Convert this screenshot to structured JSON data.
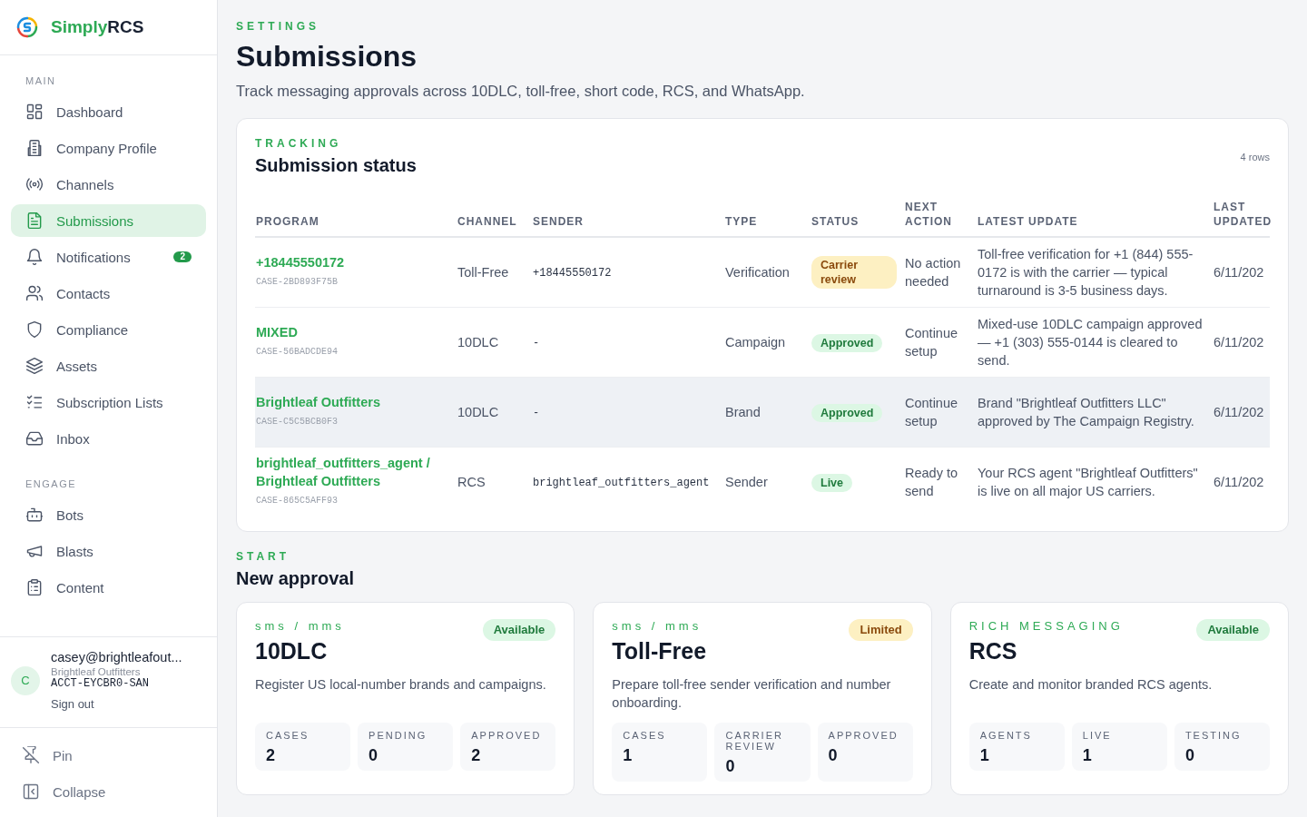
{
  "brand": {
    "name_green": "Simply",
    "name_dark": "RCS"
  },
  "sidebar": {
    "sections": [
      {
        "label": "MAIN",
        "items": [
          {
            "label": "Dashboard",
            "selected": false
          },
          {
            "label": "Company Profile",
            "selected": false
          },
          {
            "label": "Channels",
            "selected": false
          },
          {
            "label": "Submissions",
            "selected": true
          },
          {
            "label": "Notifications",
            "selected": false,
            "badge": "2"
          },
          {
            "label": "Contacts",
            "selected": false
          },
          {
            "label": "Compliance",
            "selected": false
          },
          {
            "label": "Assets",
            "selected": false
          },
          {
            "label": "Subscription Lists",
            "selected": false
          },
          {
            "label": "Inbox",
            "selected": false
          }
        ]
      },
      {
        "label": "ENGAGE",
        "items": [
          {
            "label": "Bots",
            "selected": false
          },
          {
            "label": "Blasts",
            "selected": false
          },
          {
            "label": "Content",
            "selected": false
          }
        ]
      }
    ],
    "user": {
      "avatar": "C",
      "email": "casey@brightleafout...",
      "org": "Brightleaf Outfitters",
      "account": "ACCT-EYCBR0-SAN",
      "sign_out": "Sign out"
    },
    "footer": [
      "Pin",
      "Collapse"
    ]
  },
  "header": {
    "eyebrow": "SETTINGS",
    "title": "Submissions",
    "subtitle": "Track messaging approvals across 10DLC, toll-free, short code, RCS, and WhatsApp."
  },
  "tracking": {
    "eyebrow": "TRACKING",
    "title": "Submission status",
    "count": "4 rows",
    "table": {
      "columns": [
        "PROGRAM",
        "CHANNEL",
        "SENDER",
        "TYPE",
        "STATUS",
        "NEXT ACTION",
        "LATEST UPDATE",
        "LAST UPDATED"
      ],
      "rows": [
        {
          "program": "+18445550172",
          "case": "CASE-2BD893F75B",
          "channel": "Toll-Free",
          "sender": "+18445550172",
          "type": "Verification",
          "status": "Carrier review",
          "kind": "warning",
          "next_action": "No action needed",
          "update": "Toll-free verification for +1 (844) 555-0172 is with the carrier — typical turnaround is 3-5 business days.",
          "updated": "6/11/202",
          "highlighted": false
        },
        {
          "program": "MIXED",
          "case": "CASE-56BADCDE94",
          "channel": "10DLC",
          "sender": "-",
          "type": "Campaign",
          "status": "Approved",
          "kind": "success",
          "next_action": "Continue setup",
          "update": "Mixed-use 10DLC campaign approved — +1 (303) 555-0144 is cleared to send.",
          "updated": "6/11/202",
          "highlighted": false
        },
        {
          "program": "Brightleaf Outfitters",
          "case": "CASE-C5C5BCB0F3",
          "channel": "10DLC",
          "sender": "-",
          "type": "Brand",
          "status": "Approved",
          "kind": "success",
          "next_action": "Continue setup",
          "update": "Brand \"Brightleaf Outfitters LLC\" approved by The Campaign Registry.",
          "updated": "6/11/202",
          "highlighted": true
        },
        {
          "program": "brightleaf_outfitters_agent / Brightleaf Outfitters",
          "case": "CASE-865C5AFF93",
          "channel": "RCS",
          "sender": "brightleaf_outfitters_agent",
          "type": "Sender",
          "status": "Live",
          "kind": "success",
          "next_action": "Ready to send",
          "update": "Your RCS agent \"Brightleaf Outfitters\" is live on all major US carriers.",
          "updated": "6/11/202",
          "highlighted": false
        }
      ]
    }
  },
  "start": {
    "eyebrow": "START",
    "title": "New approval",
    "cards": [
      {
        "eyebrow": "sms / mms",
        "title": "10DLC",
        "badge": "Available",
        "kind": "success",
        "description": "Register US local-number brands and campaigns.",
        "stats": [
          {
            "label": "CASES",
            "value": "2"
          },
          {
            "label": "PENDING",
            "value": "0"
          },
          {
            "label": "APPROVED",
            "value": "2"
          }
        ]
      },
      {
        "eyebrow": "sms / mms",
        "title": "Toll-Free",
        "badge": "Limited",
        "kind": "warning",
        "description": "Prepare toll-free sender verification and number onboarding.",
        "stats": [
          {
            "label": "CASES",
            "value": "1"
          },
          {
            "label": "CARRIER REVIEW",
            "value": "0"
          },
          {
            "label": "APPROVED",
            "value": "0"
          }
        ]
      },
      {
        "eyebrow": "RICH MESSAGING",
        "title": "RCS",
        "badge": "Available",
        "kind": "success",
        "description": "Create and monitor branded RCS agents.",
        "stats": [
          {
            "label": "AGENTS",
            "value": "1"
          },
          {
            "label": "LIVE",
            "value": "1"
          },
          {
            "label": "TESTING",
            "value": "0"
          }
        ]
      }
    ]
  }
}
